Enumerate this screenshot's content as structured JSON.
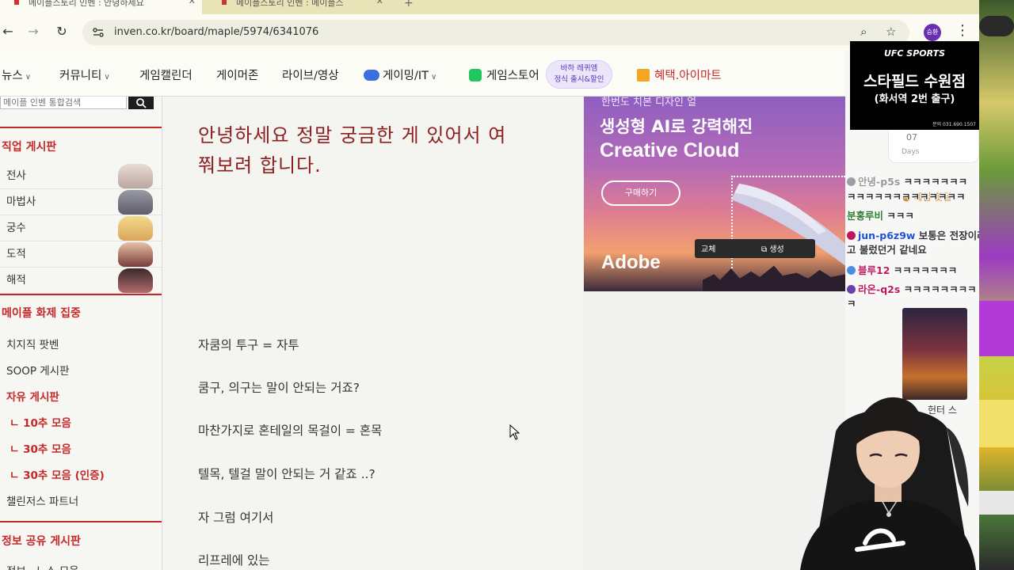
{
  "browser": {
    "tabs": [
      {
        "label": "메이플스토리 인벤 : 안녕하세요"
      },
      {
        "label": "메이플스토리 인벤 : 메이플스"
      }
    ],
    "url": "inven.co.kr/board/maple/5974/6341076",
    "profile_label": "승환"
  },
  "nav": {
    "items": [
      "뉴스",
      "커뮤니티",
      "게임캘린더",
      "게이머존",
      "라이브/영상",
      "게이밍/IT",
      "게임스토어",
      "혜택.아이마트"
    ],
    "promo_line1": "바하 레퀴엠",
    "promo_line2": "정식 출시&할인"
  },
  "sidebar": {
    "search_placeholder": "메이플 인벤 통합검색",
    "class_section_title": "직업 게시판",
    "classes": [
      "전사",
      "마법사",
      "궁수",
      "도적",
      "해적"
    ],
    "hot_section_title": "메이플 화제 집중",
    "hot_links": [
      "치지직 팟벤",
      "SOOP 게시판"
    ],
    "free_board": "자유 게시판",
    "free_subs": [
      "ㄴ 10추 모음",
      "ㄴ 30추 모음",
      "ㄴ 30추 모음 (인증)"
    ],
    "partners": "챌린저스 파트너",
    "info_section_title": "정보 공유 게시판",
    "info_partial": "정보 · 노스 모음"
  },
  "article": {
    "title_line1": "안녕하세요 정말 궁금한 게 있어서 여",
    "title_line2": "쭤보려 합니다.",
    "lines": [
      "자쿰의 투구 = 자투",
      "쿰구, 의구는 말이 안되는 거죠?",
      "마찬가지로 혼테일의 목걸이 = 혼목",
      "텔목, 텔걸 말이 안되는 거 같죠 ..?",
      "자 그럼 여기서",
      "리프레에 있는"
    ]
  },
  "ad": {
    "top_text": "한번도 치본 디자인 얼",
    "headline1": "생성형 AI로 강력해진",
    "headline2": "Creative Cloud",
    "cta": "구매하기",
    "tool1": "교체",
    "tool2": "생성",
    "brand": "Adobe",
    "colors": {
      "sky_top": "#8e5fbf",
      "sky_bottom": "#f2a06e"
    }
  },
  "ufc_ad": {
    "logo": "UFC SPORTS",
    "headline": "스타필드 수원점",
    "sub": "(화서역 2번 출구)",
    "phone": "문의 031.690.1507"
  },
  "right_panel": {
    "countdown_num": "07",
    "countdown_unit": "Days",
    "event_badge": "게임 핫딜",
    "thumb_caption": "헌터 스"
  },
  "chat": [
    {
      "user": "안녕-p5s",
      "msg": "ㅋㅋㅋㅋㅋㅋㅋ",
      "color": "#999999",
      "dot": "#9aa0a6"
    },
    {
      "user": "",
      "msg": "ㅋㅋㅋㅋㅋㅋㅋㅋㅋㅋㅋㅋㅋ",
      "color": "#333333",
      "dot": ""
    },
    {
      "user": "분홍루비",
      "msg": "ㅋㅋㅋ",
      "color": "#2e7d32",
      "dot": ""
    },
    {
      "user": "jun-p6z9w",
      "msg": "보통은 전장이라",
      "color": "#1e4fd8",
      "dot": "#c2185b"
    },
    {
      "user": "",
      "msg": "고 불렀던거 같네요",
      "color": "#333333",
      "dot": ""
    },
    {
      "user": "블루12",
      "msg": "ㅋㅋㅋㅋㅋㅋㅋ",
      "color": "#c2185b",
      "dot": "#4a90e2"
    },
    {
      "user": "라온-q2s",
      "msg": "ㅋㅋㅋㅋㅋㅋㅋㅋ",
      "color": "#c2185b",
      "dot": "#6a3fb0"
    },
    {
      "user": "",
      "msg": "ㅋ",
      "color": "#333333",
      "dot": ""
    }
  ]
}
